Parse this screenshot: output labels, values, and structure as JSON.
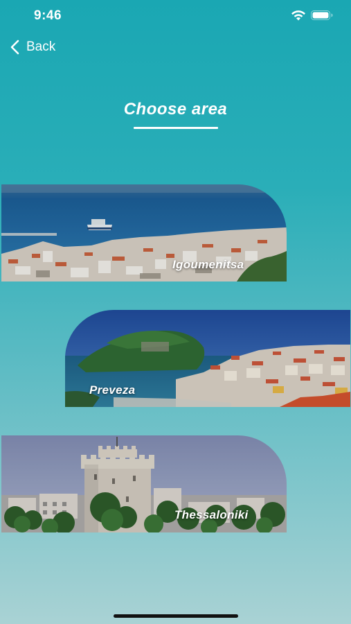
{
  "status_bar": {
    "time": "9:46"
  },
  "nav": {
    "back_label": "Back",
    "back_icon": "chevron-left-icon"
  },
  "page": {
    "title": "Choose area"
  },
  "areas": [
    {
      "name": "Igoumenitsa"
    },
    {
      "name": "Preveza"
    },
    {
      "name": "Thessaloniki"
    }
  ],
  "colors": {
    "background_top": "#1aa7b3",
    "background_bottom": "#a9d2d4",
    "text": "#ffffff"
  }
}
